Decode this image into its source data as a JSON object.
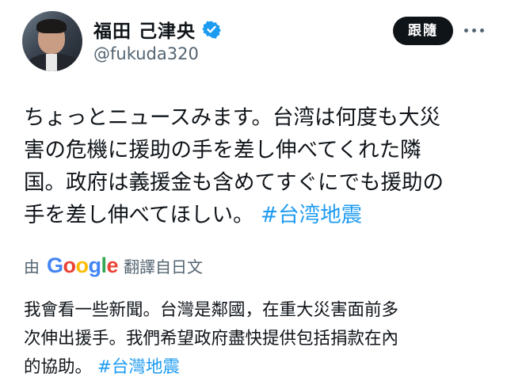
{
  "profile": {
    "display_name": "福田 己津央",
    "handle": "@fukuda320",
    "verified": true
  },
  "header": {
    "follow_label": "跟隨",
    "more_icon": "more-horizontal-icon"
  },
  "post": {
    "lines": [
      "ちょっとニュースみます。台湾は何度も大災",
      "害の危機に援助の手を差し伸べてくれた隣",
      "国。政府は義援金も含めてすぐにでも援助の",
      "手を差し伸べてほしい。"
    ],
    "hashtag": "#台湾地震"
  },
  "translation": {
    "prefix": "由",
    "provider_parts": [
      "G",
      "o",
      "o",
      "g",
      "l",
      "e"
    ],
    "suffix": "翻譯自日文",
    "lines": [
      "我會看一些新聞。台灣是鄰國，在重大災害面前多",
      "次伸出援手。我們希望政府盡快提供包括捐款在內",
      "的協助。"
    ],
    "hashtag": "#台灣地震"
  },
  "colors": {
    "text": "#0f1419",
    "secondary": "#536471",
    "link": "#1d9bf0",
    "follow_bg": "#0f1419"
  }
}
